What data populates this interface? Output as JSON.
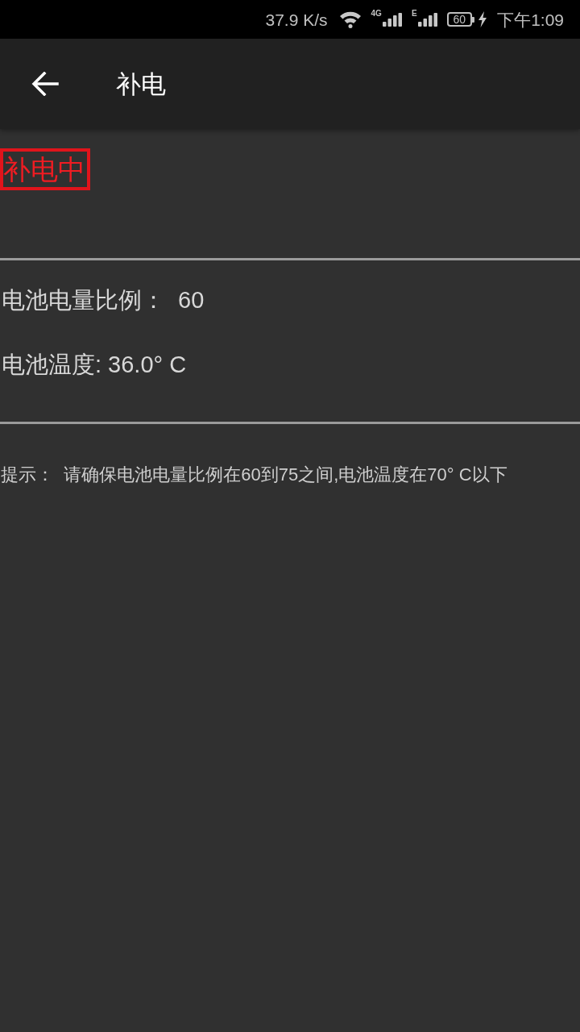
{
  "status_bar": {
    "network_speed": "37.9 K/s",
    "signals": [
      {
        "label": "4G"
      },
      {
        "label": "E"
      }
    ],
    "battery": "60",
    "charging": true,
    "time": "下午1:09"
  },
  "app_bar": {
    "title": "补电"
  },
  "status_label": "补电中",
  "readings": [
    "电池电量比例：  60",
    "电池温度: 36.0° C"
  ],
  "hint": "提示：  请确保电池电量比例在60到75之间,电池温度在70° C以下"
}
